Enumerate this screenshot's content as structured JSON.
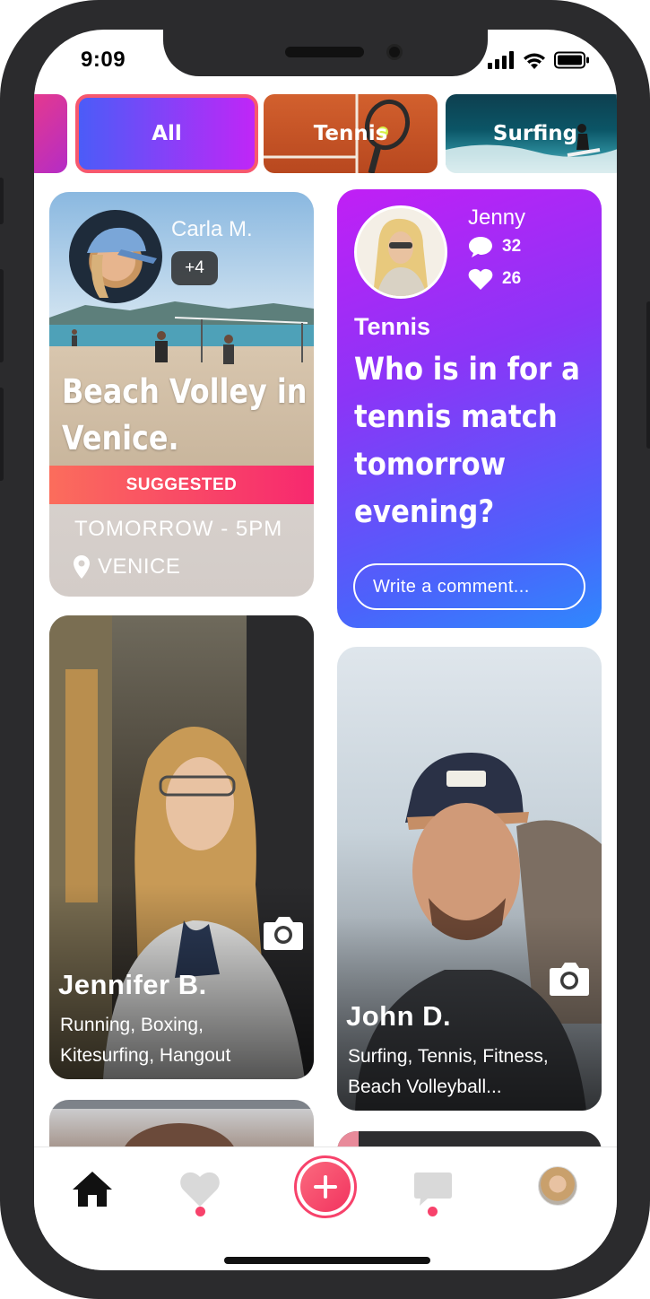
{
  "status_bar": {
    "time": "9:09"
  },
  "categories": [
    {
      "label": ""
    },
    {
      "label": "All",
      "selected": true
    },
    {
      "label": "Tennis"
    },
    {
      "label": "Surfing"
    }
  ],
  "event_card": {
    "host_name": "Carla M.",
    "extra_count": "+4",
    "title_line1": "Beach Volley in",
    "title_line2": "Venice.",
    "tag": "SUGGESTED",
    "time": "TOMORROW - 5PM",
    "location": "VENICE"
  },
  "post_card": {
    "author": "Jenny",
    "comments": "32",
    "likes": "26",
    "category": "Tennis",
    "question_lines": [
      "Who is in for a",
      "tennis match",
      "tomorrow",
      "evening?"
    ],
    "comment_placeholder": "Write a comment..."
  },
  "profiles": [
    {
      "name": "Jennifer B.",
      "interests_line1": "Running, Boxing,",
      "interests_line2": "Kitesurfing, Hangout"
    },
    {
      "name": "John D.",
      "interests_line1": "Surfing, Tennis, Fitness,",
      "interests_line2": "Beach Volleyball..."
    }
  ],
  "colors": {
    "accent": "#f7426b",
    "gradient_purple": "#c21ef5",
    "gradient_blue": "#3b7bfd"
  },
  "tabbar": {
    "items": [
      "home-icon",
      "heart-icon",
      "add-icon",
      "chat-icon",
      "profile-avatar"
    ]
  }
}
